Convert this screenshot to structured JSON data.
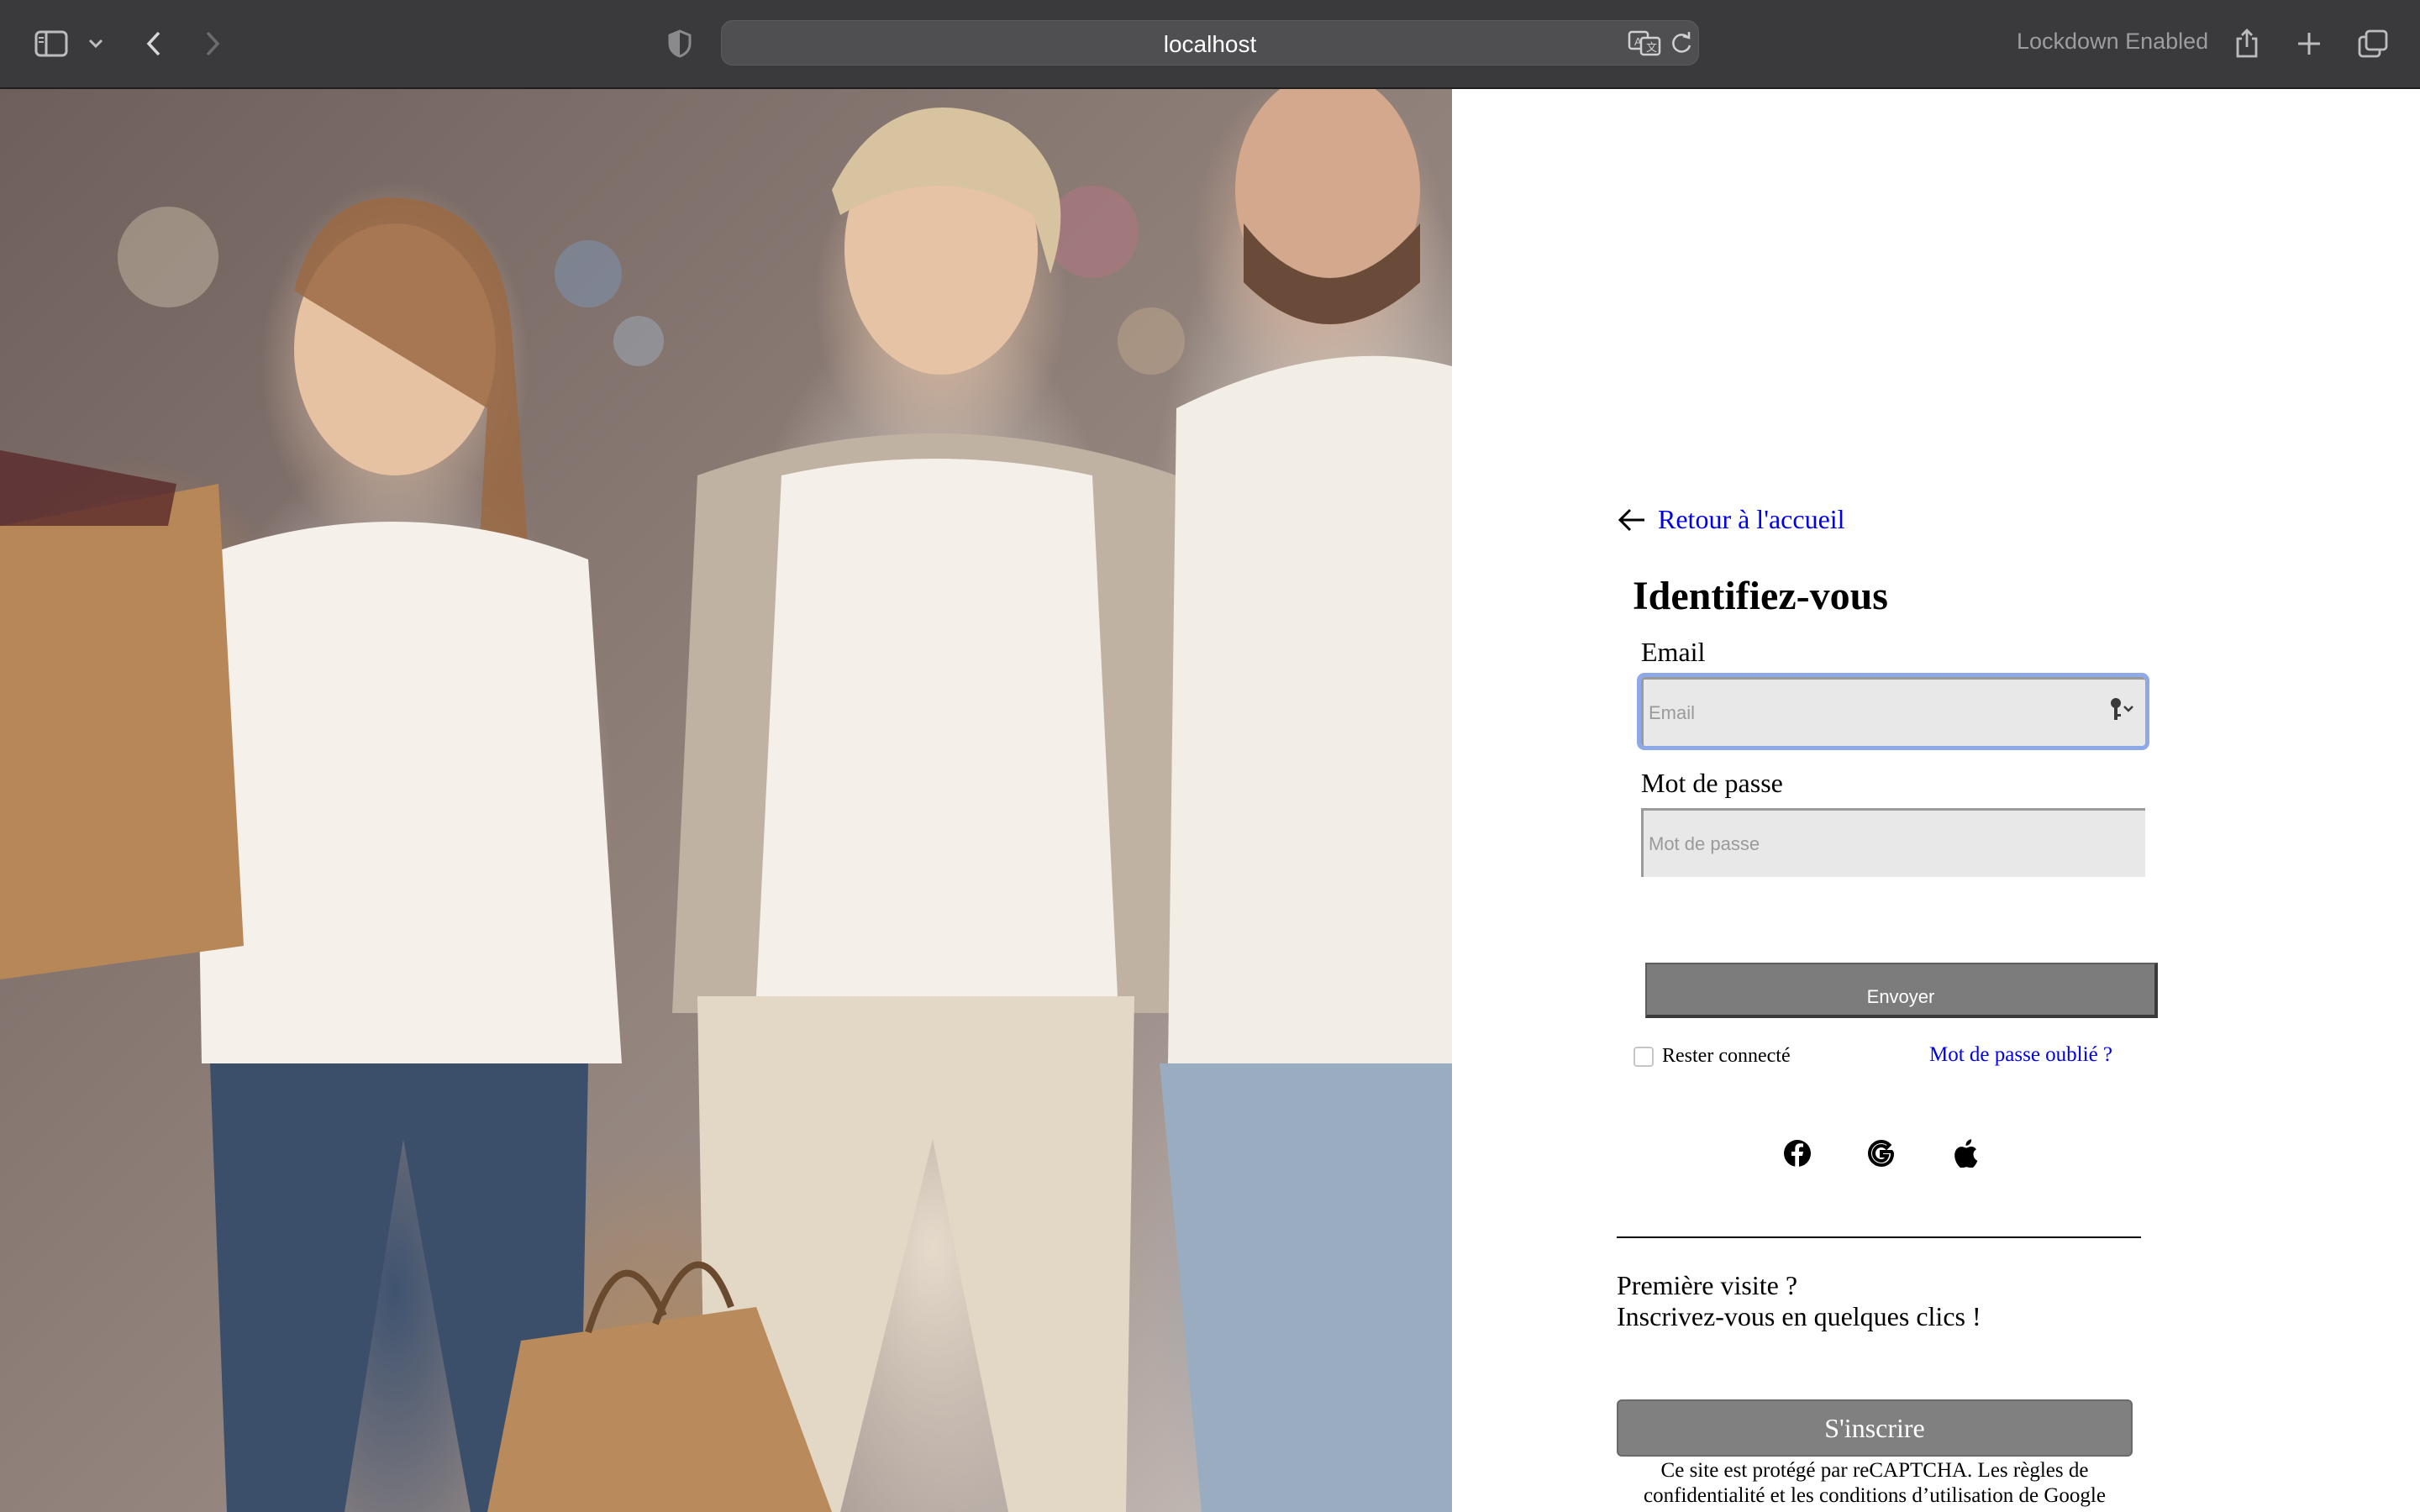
{
  "browser": {
    "url": "localhost",
    "lockdown_text": "Lockdown Enabled",
    "icons": [
      "sidebar-icon",
      "chevron-down-icon",
      "back-icon",
      "forward-icon",
      "privacy-shield-icon",
      "translate-icon",
      "reload-icon",
      "share-icon",
      "new-tab-icon",
      "tab-overview-icon"
    ]
  },
  "hero": {
    "alt": "Famille souriante avec sacs de shopping"
  },
  "login": {
    "back_link": "Retour à l'accueil",
    "title": "Identifiez-vous",
    "email_label": "Email",
    "email_placeholder": "Email",
    "password_label": "Mot de passe",
    "password_placeholder": "Mot de passe",
    "submit_label": "Envoyer",
    "remember_label": "Rester connecté",
    "forgot_label": "Mot de passe oublié ?",
    "social": [
      "facebook-icon",
      "google-icon",
      "apple-icon"
    ]
  },
  "signup": {
    "line1": "Première visite ?",
    "line2": "Inscrivez-vous en quelques clics !",
    "button_label": "S'inscrire"
  },
  "recaptcha": {
    "text": "Ce site est protégé par reCAPTCHA. Les règles de confidentialité et les conditions d’utilisation de Google"
  },
  "colors": {
    "chrome_bg": "#3a3a3c",
    "link": "#0000ee",
    "button_bg": "#7c7c7c",
    "focus_ring": "#8ea9e8"
  }
}
